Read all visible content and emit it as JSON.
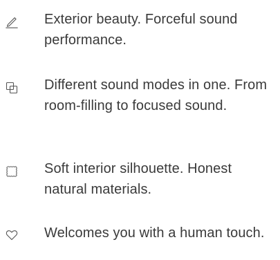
{
  "features": [
    {
      "icon": "pencil-icon",
      "text": "Exterior beauty. Forceful sound performance."
    },
    {
      "icon": "layers-icon",
      "text": "Different sound modes in one. From room-filling to focused sound."
    },
    {
      "icon": "fabric-square-icon",
      "text": "Soft interior silhouette. Honest natural materials."
    },
    {
      "icon": "heart-icon",
      "text": "Welcomes you with a human touch."
    }
  ],
  "colors": {
    "text": "#3a3a3a",
    "icon": "#555555",
    "background": "#ffffff"
  }
}
